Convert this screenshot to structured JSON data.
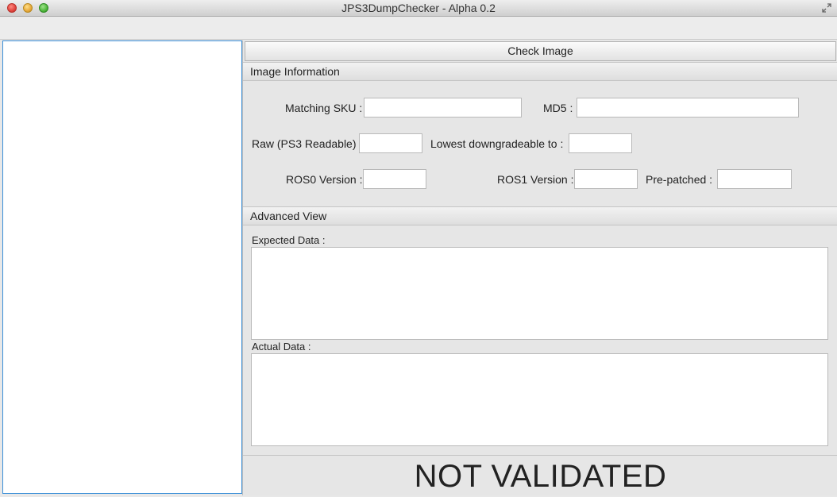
{
  "window": {
    "title": "JPS3DumpChecker - Alpha 0.2"
  },
  "icons": {
    "fullscreen": "fullscreen-arrows-icon"
  },
  "actions": {
    "check_image": "Check Image"
  },
  "image_information": {
    "header": "Image Information",
    "matching_sku": {
      "label": "Matching SKU :",
      "value": ""
    },
    "md5": {
      "label": "MD5 :",
      "value": ""
    },
    "raw": {
      "label": "Raw (PS3 Readable) :",
      "value": ""
    },
    "lowest_downgradeable": {
      "label": "Lowest downgradeable to :",
      "value": ""
    },
    "ros0_version": {
      "label": "ROS0 Version :",
      "value": ""
    },
    "ros1_version": {
      "label": "ROS1 Version :",
      "value": ""
    },
    "pre_patched": {
      "label": "Pre-patched :",
      "value": ""
    }
  },
  "advanced_view": {
    "header": "Advanced View",
    "expected_label": "Expected Data :",
    "expected_value": "",
    "actual_label": "Actual Data :",
    "actual_value": ""
  },
  "status": {
    "text": "NOT VALIDATED"
  }
}
